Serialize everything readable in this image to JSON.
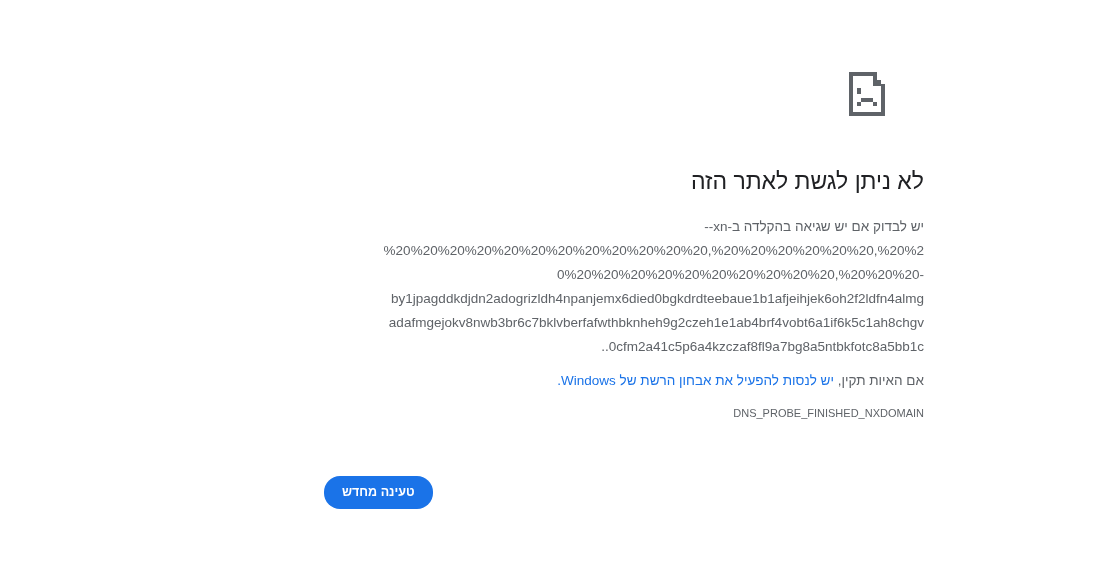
{
  "title": "לא ניתן לגשת לאתר הזה",
  "description_lines": [
    "יש לבדוק אם יש שגיאה בהקלדה ב-xn--",
    "%20%20%20%20%20%20%20%20%20%20%20%20,%20%20%20%20%20%20,%20%2",
    "0%20%20%20%20%20%20%20%20%20%20,%20%20%20-",
    "by1jpagddkdjdn2adogrizldh4npanjemx6died0bgkdrdteebaue1b1afjeihjek6oh2f2ldfn4almg",
    "adafmgejokv8nwb3br6c7bklvberfafwthbknheh9g2czeh1e1ab4brf4vobt6a1if6k5c1ah8chgv",
    "..0cfm2a41c5p6a4kzczaf8fl9a7bg8a5ntbkfotc8a5bb1c"
  ],
  "suggestion": {
    "text": "אם האיות תקין, ",
    "link": "יש לנסות להפעיל את אבחון הרשת של Windows."
  },
  "error_code": "DNS_PROBE_FINISHED_NXDOMAIN",
  "reload_button": "טעינה מחדש"
}
